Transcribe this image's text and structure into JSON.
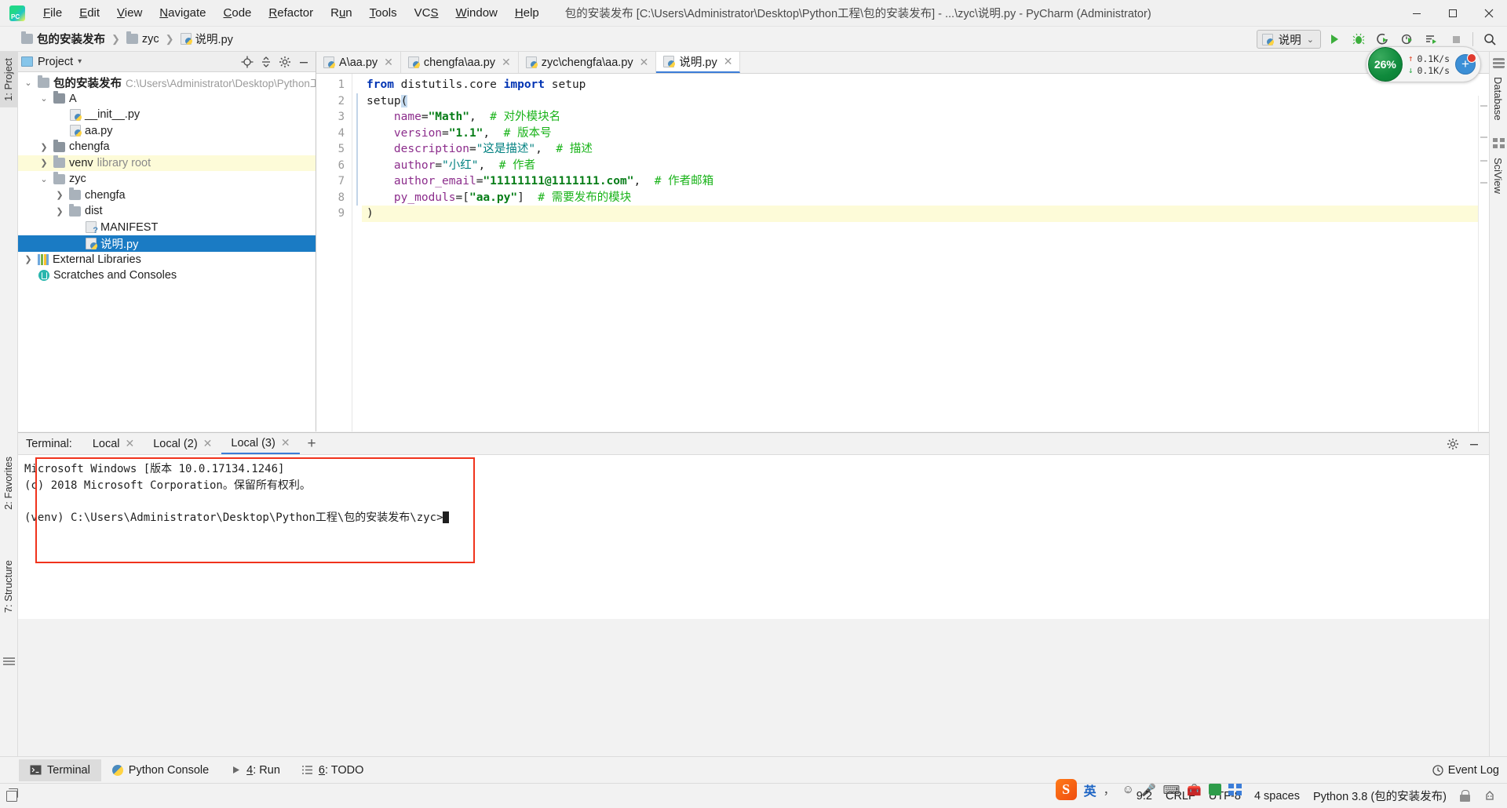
{
  "window": {
    "title": "包的安装发布 [C:\\Users\\Administrator\\Desktop\\Python工程\\包的安装发布] - ...\\zyc\\说明.py - PyCharm (Administrator)",
    "minimize_label": "—",
    "maximize_label": "▢",
    "close_label": "✕",
    "logo_name": "pycharm-logo"
  },
  "menubar": {
    "items": [
      {
        "label": "File"
      },
      {
        "label": "Edit"
      },
      {
        "label": "View"
      },
      {
        "label": "Navigate"
      },
      {
        "label": "Code"
      },
      {
        "label": "Refactor"
      },
      {
        "label": "Run"
      },
      {
        "label": "Tools"
      },
      {
        "label": "VCS"
      },
      {
        "label": "Window"
      },
      {
        "label": "Help"
      }
    ]
  },
  "breadcrumb": {
    "items": [
      {
        "label": "包的安装发布",
        "icon": "folder-icon"
      },
      {
        "label": "zyc",
        "icon": "folder-icon"
      },
      {
        "label": "说明.py",
        "icon": "python-file-icon"
      }
    ],
    "separator": "❯"
  },
  "toolbar": {
    "run_config": {
      "label": "说明",
      "icon": "python-file-icon",
      "chevron": "⌄"
    },
    "buttons": [
      {
        "name": "run-button",
        "title": "Run"
      },
      {
        "name": "debug-button",
        "title": "Debug"
      },
      {
        "name": "run-coverage-button",
        "title": "Run with Coverage"
      },
      {
        "name": "profile-button",
        "title": "Profile"
      },
      {
        "name": "run-with-console-button",
        "title": "Run with console"
      },
      {
        "name": "stop-button",
        "title": "Stop"
      },
      {
        "name": "search-everywhere-button",
        "title": "Search Everywhere"
      }
    ]
  },
  "left_tool_strip": {
    "items": [
      {
        "label": "1: Project",
        "selected": true
      },
      {
        "label": "2: Favorites",
        "selected": false
      },
      {
        "label": "7: Structure",
        "selected": false
      }
    ]
  },
  "right_tool_strip": {
    "items": [
      {
        "label": "Database"
      },
      {
        "label": "SciView"
      }
    ]
  },
  "project_panel": {
    "title": "Project",
    "chevron": "▾",
    "header_icons": [
      {
        "name": "locate-icon"
      },
      {
        "name": "collapse-all-icon"
      },
      {
        "name": "settings-gear-icon"
      },
      {
        "name": "hide-panel-icon"
      }
    ],
    "tree": [
      {
        "label": "包的安装发布",
        "path": "C:\\Users\\Administrator\\Desktop\\Python工程",
        "indent": 0,
        "arrow": "v",
        "icon": "folder-icon",
        "bold": true
      },
      {
        "label": "A",
        "path": "",
        "indent": 1,
        "arrow": "v",
        "icon": "module-folder-icon",
        "bold": false
      },
      {
        "label": "__init__.py",
        "path": "",
        "indent": 3,
        "arrow": "",
        "icon": "python-file-icon",
        "bold": false
      },
      {
        "label": "aa.py",
        "path": "",
        "indent": 3,
        "arrow": "",
        "icon": "python-file-icon",
        "bold": false
      },
      {
        "label": "chengfa",
        "path": "",
        "indent": 1,
        "arrow": ">",
        "icon": "module-folder-icon",
        "bold": false
      },
      {
        "label": "venv",
        "path": "library root",
        "indent": 1,
        "arrow": ">",
        "icon": "folder-icon",
        "bold": false,
        "highlight": true
      },
      {
        "label": "zyc",
        "path": "",
        "indent": 1,
        "arrow": "v",
        "icon": "folder-icon",
        "bold": false
      },
      {
        "label": "chengfa",
        "path": "",
        "indent": 2,
        "arrow": ">",
        "icon": "folder-icon",
        "bold": false
      },
      {
        "label": "dist",
        "path": "",
        "indent": 2,
        "arrow": ">",
        "icon": "folder-icon",
        "bold": false
      },
      {
        "label": "MANIFEST",
        "path": "",
        "indent": 3,
        "arrow": "",
        "icon": "manifest-file-icon",
        "bold": false
      },
      {
        "label": "说明.py",
        "path": "",
        "indent": 3,
        "arrow": "",
        "icon": "python-file-icon",
        "bold": false,
        "selected": true
      },
      {
        "label": "External Libraries",
        "path": "",
        "indent": 0,
        "arrow": ">",
        "icon": "library-icon",
        "bold": false
      },
      {
        "label": "Scratches and Consoles",
        "path": "",
        "indent": 0,
        "arrow": "",
        "icon": "scratches-icon",
        "bold": false
      }
    ]
  },
  "editor": {
    "tabs": [
      {
        "label": "A\\aa.py",
        "icon": "python-file-icon",
        "active": false,
        "close": "✕"
      },
      {
        "label": "chengfa\\aa.py",
        "icon": "python-file-icon",
        "active": false,
        "close": "✕"
      },
      {
        "label": "zyc\\chengfa\\aa.py",
        "icon": "python-file-icon",
        "active": false,
        "close": "✕"
      },
      {
        "label": "说明.py",
        "icon": "python-file-icon",
        "active": true,
        "close": "✕"
      }
    ],
    "line_numbers": [
      "1",
      "2",
      "3",
      "4",
      "5",
      "6",
      "7",
      "8",
      "9"
    ],
    "code_lines": [
      {
        "n": 1,
        "text": "from distutils.core import setup"
      },
      {
        "n": 2,
        "text": "setup("
      },
      {
        "n": 3,
        "text": "    name=\"Math\",  # 对外模块名"
      },
      {
        "n": 4,
        "text": "    version=\"1.1\",  # 版本号"
      },
      {
        "n": 5,
        "text": "    description=\"这是描述\",  # 描述"
      },
      {
        "n": 6,
        "text": "    author=\"小红\",  # 作者"
      },
      {
        "n": 7,
        "text": "    author_email=\"11111111@1111111.com\",  # 作者邮箱"
      },
      {
        "n": 8,
        "text": "    py_moduls=[\"aa.py\"]  # 需要发布的模块"
      },
      {
        "n": 9,
        "text": ")"
      }
    ],
    "current_line": 9
  },
  "memory_widget": {
    "percent": "26%",
    "upload_rate": "0.1K/s",
    "download_rate": "0.1K/s",
    "up_arrow": "↑",
    "down_arrow": "↓",
    "plus_label": "+"
  },
  "terminal": {
    "label": "Terminal:",
    "tabs": [
      {
        "label": "Local",
        "active": false,
        "close": "✕"
      },
      {
        "label": "Local (2)",
        "active": false,
        "close": "✕"
      },
      {
        "label": "Local (3)",
        "active": true,
        "close": "✕"
      }
    ],
    "add_tab": "+",
    "settings_icon": "gear-icon",
    "hide_icon": "minimize-icon",
    "lines": [
      "Microsoft Windows [版本 10.0.17134.1246]",
      "(c) 2018 Microsoft Corporation。保留所有权利。",
      "",
      "(venv) C:\\Users\\Administrator\\Desktop\\Python工程\\包的安装发布\\zyc>"
    ],
    "highlight_color": "#f0331c"
  },
  "bottom_bar": {
    "items": [
      {
        "label": "Terminal",
        "icon": "terminal-icon",
        "active": true
      },
      {
        "label": "Python Console",
        "icon": "python-icon",
        "active": false
      },
      {
        "label": "4: Run",
        "icon": "run-icon",
        "active": false
      },
      {
        "label": "6: TODO",
        "icon": "todo-icon",
        "active": false
      }
    ],
    "event_log": {
      "label": "Event Log",
      "icon": "event-log-icon"
    }
  },
  "status_bar": {
    "caret_position": "9:2",
    "line_separator": "CRLF",
    "encoding": "UTF-8",
    "indent": "4 spaces",
    "interpreter": "Python 3.8 (包的安装发布)",
    "lock_icon": "lock-icon",
    "inspection_icon": "inspector-icon",
    "doc_icon": "show-layout-icon"
  },
  "ime_tray": {
    "logo": "S",
    "mode": "英",
    "icons": [
      "comma-icon",
      "smiley-icon",
      "microphone-icon",
      "keyboard-icon",
      "toolbox-icon",
      "bag-icon",
      "grid-icon"
    ]
  },
  "colors": {
    "accent": "#3b7dd8",
    "selection": "#1a7bc4",
    "highlight_row": "#fdfbd8",
    "keyword": "#0033b3",
    "string": "#067d17",
    "comment": "#19b319",
    "kwarg": "#8c2d8c",
    "terminal_box": "#f0331c",
    "memory_green": "#0f8a3c"
  }
}
